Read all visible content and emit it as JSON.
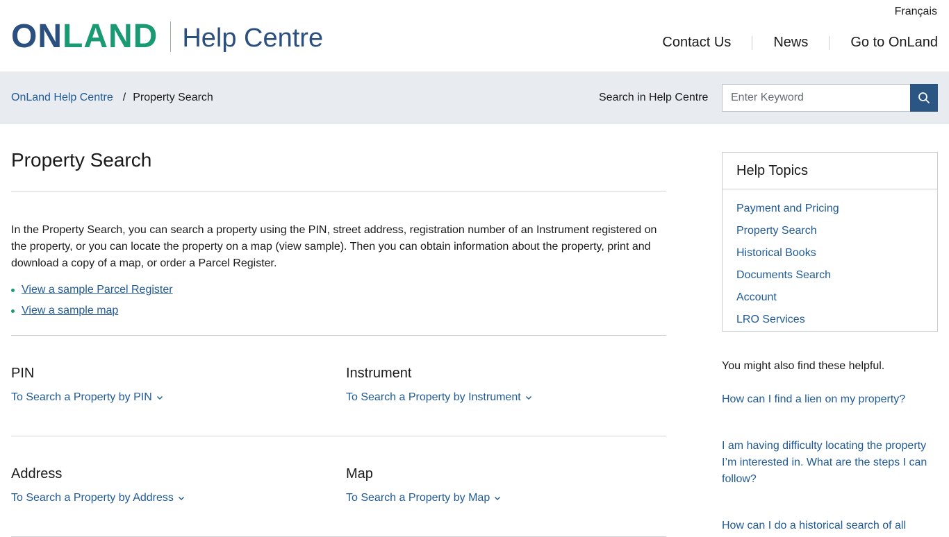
{
  "header": {
    "logo_on": "ON",
    "logo_land": "LAND",
    "logo_help": "Help Centre",
    "language_link": "Français",
    "nav": [
      "Contact Us",
      "News",
      "Go to OnLand"
    ]
  },
  "breadcrumb": {
    "home": "OnLand Help Centre",
    "separator": "/",
    "current": "Property Search"
  },
  "search": {
    "label": "Search in Help Centre",
    "placeholder": "Enter Keyword",
    "icon": "search-icon"
  },
  "main": {
    "title": "Property Search",
    "intro": "In the Property Search, you can search a property using the PIN, street address, registration number of an Instrument registered on the property, or you can locate the property on a map (view sample). Then you can obtain information about the property, print and download a copy of a map, or order a Parcel Register.",
    "links": [
      "View a sample Parcel Register",
      "View a sample map"
    ],
    "sections": [
      {
        "title": "PIN",
        "link": "To Search a Property by PIN"
      },
      {
        "title": "Instrument",
        "link": "To Search a Property by Instrument"
      },
      {
        "title": "Address",
        "link": "To Search a Property by Address"
      },
      {
        "title": "Map",
        "link": "To Search a Property by Map"
      }
    ]
  },
  "sidebar": {
    "topics_title": "Help Topics",
    "topics": [
      "Payment and Pricing",
      "Property Search",
      "Historical Books",
      "Documents Search",
      "Account",
      "LRO Services"
    ],
    "helpful_title": "You might also find these helpful.",
    "helpful": [
      "How can I find a lien on my property?",
      "I am having difficulty locating the property I’m interested in. What are the steps I can follow?",
      "How can I do a historical search of all"
    ]
  },
  "colors": {
    "brand_blue": "#2b4f7e",
    "brand_green": "#1a9a72",
    "link": "#1f5a96",
    "breadcrumb_bg": "#e8ecf1",
    "search_button": "#2b5582"
  }
}
